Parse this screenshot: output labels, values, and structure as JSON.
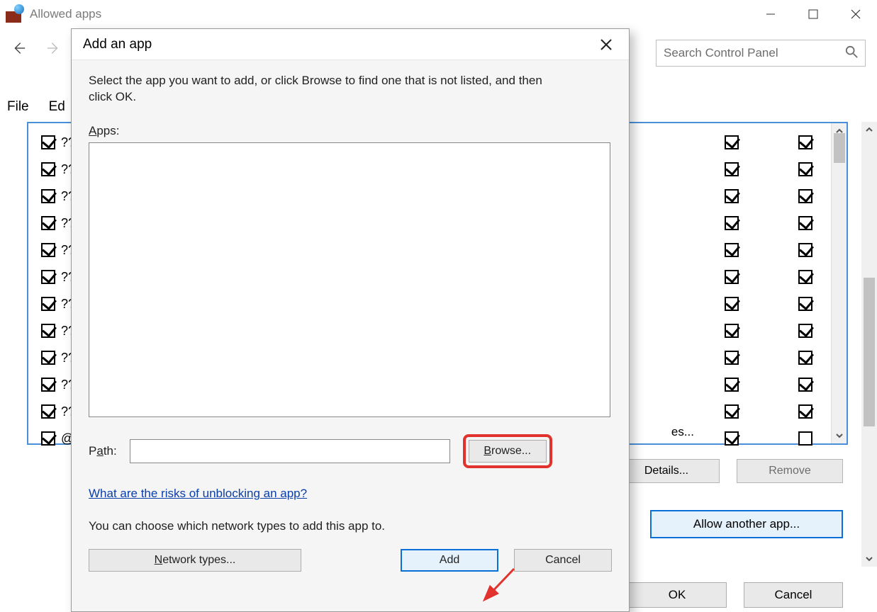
{
  "parent": {
    "title": "Allowed apps",
    "menu": {
      "file": "File",
      "edit": "Ed"
    },
    "nav": {},
    "search_placeholder": "Search Control Panel",
    "list": {
      "rows": [
        {
          "label": "??"
        },
        {
          "label": "??"
        },
        {
          "label": "??"
        },
        {
          "label": "??"
        },
        {
          "label": "??"
        },
        {
          "label": "??"
        },
        {
          "label": "??"
        },
        {
          "label": "??"
        },
        {
          "label": "??"
        },
        {
          "label": "??"
        },
        {
          "label": "??"
        },
        {
          "label": "@"
        }
      ],
      "es_fragment": "es...",
      "right_last_unchecked": true
    },
    "buttons": {
      "details": "Details...",
      "remove": "Remove",
      "allow_another": "Allow another app...",
      "ok": "OK",
      "cancel": "Cancel"
    }
  },
  "dialog": {
    "title": "Add an app",
    "instruction": "Select the app you want to add, or click Browse to find one that is not listed, and then click OK.",
    "apps_label": "Apps:",
    "path_label": "Path:",
    "path_value": "",
    "browse_pre": "",
    "browse_u": "B",
    "browse_post": "rowse...",
    "risks_link": "What are the risks of unblocking an app?",
    "network_text": "You can choose which network types to add this app to.",
    "network_types_pre": "",
    "network_types_u": "N",
    "network_types_post": "etwork types...",
    "add": "Add",
    "cancel": "Cancel"
  }
}
